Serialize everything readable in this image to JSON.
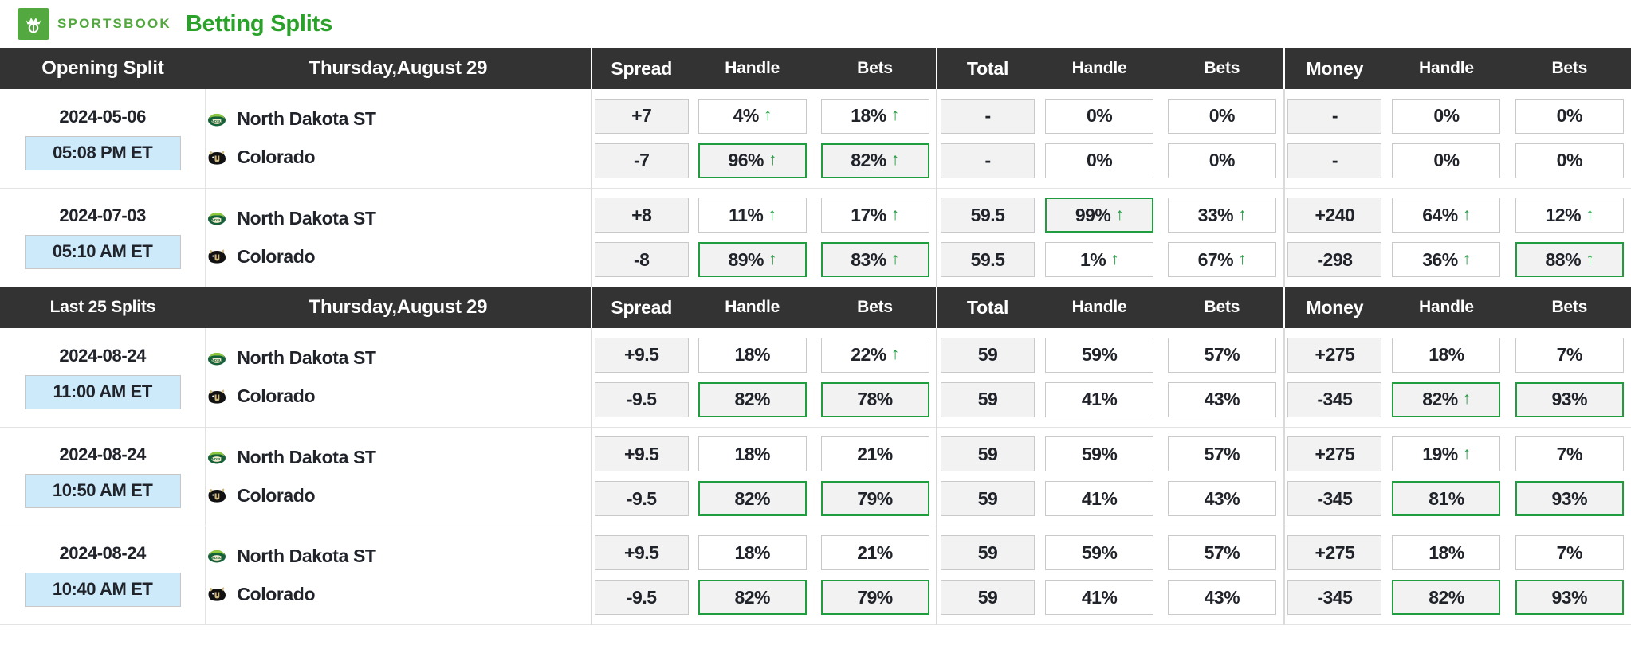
{
  "brand": {
    "logo_icon": "draftkings-crown-icon",
    "wordmark": "SPORTSBOOK",
    "page_title": "Betting Splits"
  },
  "sections": [
    {
      "title": "Opening Split",
      "title_size": "large",
      "date": "Thursday,August 29",
      "groups": [
        {
          "main": "Spread",
          "handle": "Handle",
          "bets": "Bets"
        },
        {
          "main": "Total",
          "handle": "Handle",
          "bets": "Bets"
        },
        {
          "main": "Money",
          "handle": "Handle",
          "bets": "Bets"
        }
      ],
      "rows": [
        {
          "date": "2024-05-06",
          "time": "05:08 PM ET",
          "teams": [
            {
              "name": "North Dakota ST",
              "logo": "north-dakota-state-bison-logo"
            },
            {
              "name": "Colorado",
              "logo": "colorado-buffaloes-logo"
            }
          ],
          "spread": [
            {
              "v": "+7",
              "style": "gray"
            },
            {
              "v": "-7",
              "style": "gray"
            }
          ],
          "spread_handle": [
            {
              "v": "4%",
              "style": "white",
              "arrow": true
            },
            {
              "v": "96%",
              "style": "gray-green",
              "arrow": true
            }
          ],
          "spread_bets": [
            {
              "v": "18%",
              "style": "white",
              "arrow": true
            },
            {
              "v": "82%",
              "style": "gray-green",
              "arrow": true
            }
          ],
          "total": [
            {
              "v": "-",
              "style": "gray"
            },
            {
              "v": "-",
              "style": "gray"
            }
          ],
          "total_handle": [
            {
              "v": "0%",
              "style": "white"
            },
            {
              "v": "0%",
              "style": "white"
            }
          ],
          "total_bets": [
            {
              "v": "0%",
              "style": "white"
            },
            {
              "v": "0%",
              "style": "white"
            }
          ],
          "money": [
            {
              "v": "-",
              "style": "gray"
            },
            {
              "v": "-",
              "style": "gray"
            }
          ],
          "money_handle": [
            {
              "v": "0%",
              "style": "white"
            },
            {
              "v": "0%",
              "style": "white"
            }
          ],
          "money_bets": [
            {
              "v": "0%",
              "style": "white"
            },
            {
              "v": "0%",
              "style": "white"
            }
          ]
        },
        {
          "date": "2024-07-03",
          "time": "05:10 AM ET",
          "teams": [
            {
              "name": "North Dakota ST",
              "logo": "north-dakota-state-bison-logo"
            },
            {
              "name": "Colorado",
              "logo": "colorado-buffaloes-logo"
            }
          ],
          "spread": [
            {
              "v": "+8",
              "style": "gray"
            },
            {
              "v": "-8",
              "style": "gray"
            }
          ],
          "spread_handle": [
            {
              "v": "11%",
              "style": "white",
              "arrow": true
            },
            {
              "v": "89%",
              "style": "gray-green",
              "arrow": true
            }
          ],
          "spread_bets": [
            {
              "v": "17%",
              "style": "white",
              "arrow": true
            },
            {
              "v": "83%",
              "style": "gray-green",
              "arrow": true
            }
          ],
          "total": [
            {
              "v": "59.5",
              "style": "gray"
            },
            {
              "v": "59.5",
              "style": "gray"
            }
          ],
          "total_handle": [
            {
              "v": "99%",
              "style": "gray-green",
              "arrow": true
            },
            {
              "v": "1%",
              "style": "white",
              "arrow": true
            }
          ],
          "total_bets": [
            {
              "v": "33%",
              "style": "white",
              "arrow": true
            },
            {
              "v": "67%",
              "style": "white",
              "arrow": true
            }
          ],
          "money": [
            {
              "v": "+240",
              "style": "gray"
            },
            {
              "v": "-298",
              "style": "gray"
            }
          ],
          "money_handle": [
            {
              "v": "64%",
              "style": "white",
              "arrow": true
            },
            {
              "v": "36%",
              "style": "white",
              "arrow": true
            }
          ],
          "money_bets": [
            {
              "v": "12%",
              "style": "white",
              "arrow": true
            },
            {
              "v": "88%",
              "style": "gray-green",
              "arrow": true
            }
          ]
        }
      ]
    },
    {
      "title": "Last 25 Splits",
      "title_size": "small",
      "date": "Thursday,August 29",
      "groups": [
        {
          "main": "Spread",
          "handle": "Handle",
          "bets": "Bets"
        },
        {
          "main": "Total",
          "handle": "Handle",
          "bets": "Bets"
        },
        {
          "main": "Money",
          "handle": "Handle",
          "bets": "Bets"
        }
      ],
      "rows": [
        {
          "date": "2024-08-24",
          "time": "11:00 AM ET",
          "teams": [
            {
              "name": "North Dakota ST",
              "logo": "north-dakota-state-bison-logo"
            },
            {
              "name": "Colorado",
              "logo": "colorado-buffaloes-logo"
            }
          ],
          "spread": [
            {
              "v": "+9.5",
              "style": "gray"
            },
            {
              "v": "-9.5",
              "style": "gray"
            }
          ],
          "spread_handle": [
            {
              "v": "18%",
              "style": "white"
            },
            {
              "v": "82%",
              "style": "gray-green"
            }
          ],
          "spread_bets": [
            {
              "v": "22%",
              "style": "white",
              "arrow": true
            },
            {
              "v": "78%",
              "style": "gray-green"
            }
          ],
          "total": [
            {
              "v": "59",
              "style": "gray"
            },
            {
              "v": "59",
              "style": "gray"
            }
          ],
          "total_handle": [
            {
              "v": "59%",
              "style": "white"
            },
            {
              "v": "41%",
              "style": "white"
            }
          ],
          "total_bets": [
            {
              "v": "57%",
              "style": "white"
            },
            {
              "v": "43%",
              "style": "white"
            }
          ],
          "money": [
            {
              "v": "+275",
              "style": "gray"
            },
            {
              "v": "-345",
              "style": "gray"
            }
          ],
          "money_handle": [
            {
              "v": "18%",
              "style": "white"
            },
            {
              "v": "82%",
              "style": "gray-green",
              "arrow": true
            }
          ],
          "money_bets": [
            {
              "v": "7%",
              "style": "white"
            },
            {
              "v": "93%",
              "style": "gray-green"
            }
          ]
        },
        {
          "date": "2024-08-24",
          "time": "10:50 AM ET",
          "teams": [
            {
              "name": "North Dakota ST",
              "logo": "north-dakota-state-bison-logo"
            },
            {
              "name": "Colorado",
              "logo": "colorado-buffaloes-logo"
            }
          ],
          "spread": [
            {
              "v": "+9.5",
              "style": "gray"
            },
            {
              "v": "-9.5",
              "style": "gray"
            }
          ],
          "spread_handle": [
            {
              "v": "18%",
              "style": "white"
            },
            {
              "v": "82%",
              "style": "gray-green"
            }
          ],
          "spread_bets": [
            {
              "v": "21%",
              "style": "white"
            },
            {
              "v": "79%",
              "style": "gray-green"
            }
          ],
          "total": [
            {
              "v": "59",
              "style": "gray"
            },
            {
              "v": "59",
              "style": "gray"
            }
          ],
          "total_handle": [
            {
              "v": "59%",
              "style": "white"
            },
            {
              "v": "41%",
              "style": "white"
            }
          ],
          "total_bets": [
            {
              "v": "57%",
              "style": "white"
            },
            {
              "v": "43%",
              "style": "white"
            }
          ],
          "money": [
            {
              "v": "+275",
              "style": "gray"
            },
            {
              "v": "-345",
              "style": "gray"
            }
          ],
          "money_handle": [
            {
              "v": "19%",
              "style": "white",
              "arrow": true
            },
            {
              "v": "81%",
              "style": "gray-green"
            }
          ],
          "money_bets": [
            {
              "v": "7%",
              "style": "white"
            },
            {
              "v": "93%",
              "style": "gray-green"
            }
          ]
        },
        {
          "date": "2024-08-24",
          "time": "10:40 AM ET",
          "teams": [
            {
              "name": "North Dakota ST",
              "logo": "north-dakota-state-bison-logo"
            },
            {
              "name": "Colorado",
              "logo": "colorado-buffaloes-logo"
            }
          ],
          "spread": [
            {
              "v": "+9.5",
              "style": "gray"
            },
            {
              "v": "-9.5",
              "style": "gray"
            }
          ],
          "spread_handle": [
            {
              "v": "18%",
              "style": "white"
            },
            {
              "v": "82%",
              "style": "gray-green"
            }
          ],
          "spread_bets": [
            {
              "v": "21%",
              "style": "white"
            },
            {
              "v": "79%",
              "style": "gray-green"
            }
          ],
          "total": [
            {
              "v": "59",
              "style": "gray"
            },
            {
              "v": "59",
              "style": "gray"
            }
          ],
          "total_handle": [
            {
              "v": "59%",
              "style": "white"
            },
            {
              "v": "41%",
              "style": "white"
            }
          ],
          "total_bets": [
            {
              "v": "57%",
              "style": "white"
            },
            {
              "v": "43%",
              "style": "white"
            }
          ],
          "money": [
            {
              "v": "+275",
              "style": "gray"
            },
            {
              "v": "-345",
              "style": "gray"
            }
          ],
          "money_handle": [
            {
              "v": "18%",
              "style": "white"
            },
            {
              "v": "82%",
              "style": "gray-green"
            }
          ],
          "money_bets": [
            {
              "v": "7%",
              "style": "white"
            },
            {
              "v": "93%",
              "style": "gray-green"
            }
          ]
        }
      ]
    }
  ],
  "colors": {
    "brand_green": "#53a93f",
    "title_green": "#2aa22a",
    "header_bg": "#333333",
    "highlight_green": "#1f9d3f",
    "time_badge_bg": "#cdeafb",
    "pill_gray": "#f2f2f2"
  },
  "arrow_glyph": "↑"
}
